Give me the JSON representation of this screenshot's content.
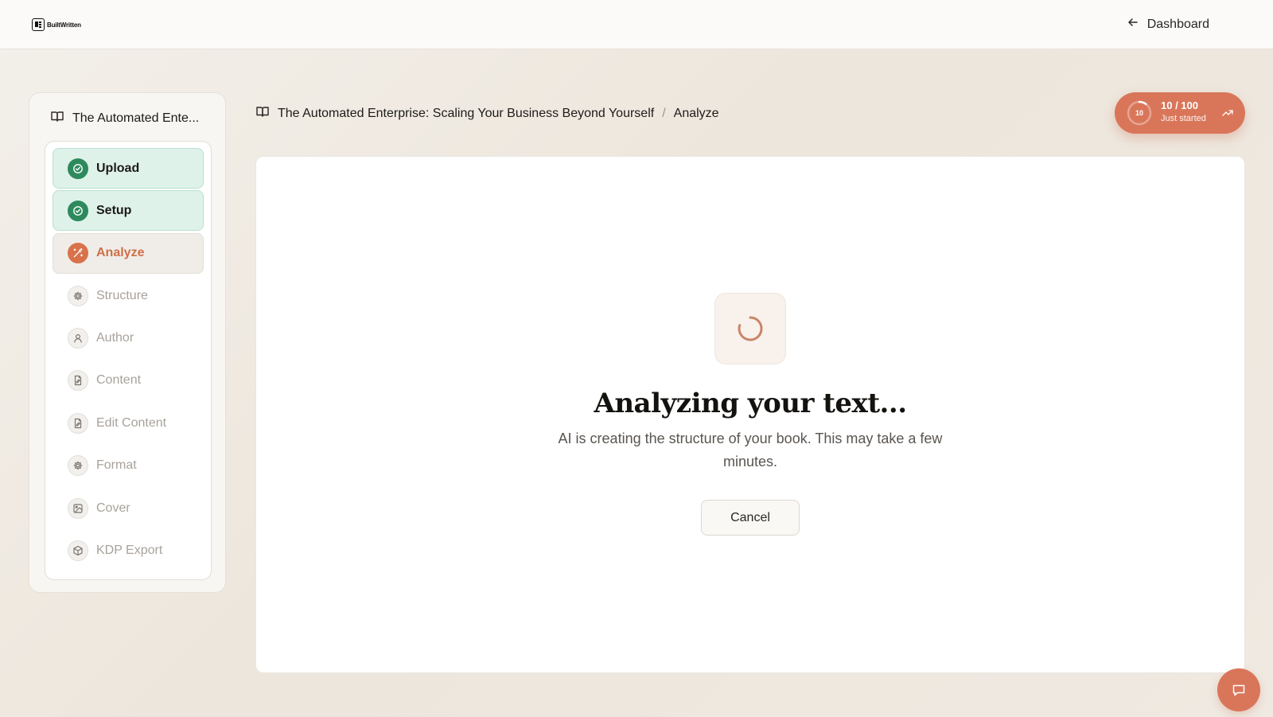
{
  "app": {
    "logo_text": "BuiltWritten",
    "dashboard_link": "Dashboard"
  },
  "sidebar": {
    "book_title": "The Automated Ente...",
    "steps": [
      {
        "label": "Upload",
        "status": "done",
        "icon": "check-circle-icon"
      },
      {
        "label": "Setup",
        "status": "done",
        "icon": "check-circle-icon"
      },
      {
        "label": "Analyze",
        "status": "active",
        "icon": "magic-wand-icon"
      },
      {
        "label": "Structure",
        "status": "pending",
        "icon": "gear-icon"
      },
      {
        "label": "Author",
        "status": "pending",
        "icon": "user-icon"
      },
      {
        "label": "Content",
        "status": "pending",
        "icon": "document-edit-icon"
      },
      {
        "label": "Edit Content",
        "status": "pending",
        "icon": "document-edit-icon"
      },
      {
        "label": "Format",
        "status": "pending",
        "icon": "gear-icon"
      },
      {
        "label": "Cover",
        "status": "pending",
        "icon": "image-icon"
      },
      {
        "label": "KDP Export",
        "status": "pending",
        "icon": "package-icon"
      }
    ]
  },
  "breadcrumb": {
    "book": "The Automated Enterprise: Scaling Your Business Beyond Yourself",
    "separator": "/",
    "current": "Analyze"
  },
  "score": {
    "ring_value": "10",
    "value": 10,
    "max": 100,
    "label": "10 / 100",
    "status": "Just started"
  },
  "main": {
    "heading": "Analyzing your text...",
    "description": "AI is creating the structure of your book. This may take a few minutes.",
    "cancel_label": "Cancel"
  },
  "colors": {
    "accent": "#d9765a",
    "success": "#2e8a5c",
    "success_bg": "#dff2ea"
  }
}
